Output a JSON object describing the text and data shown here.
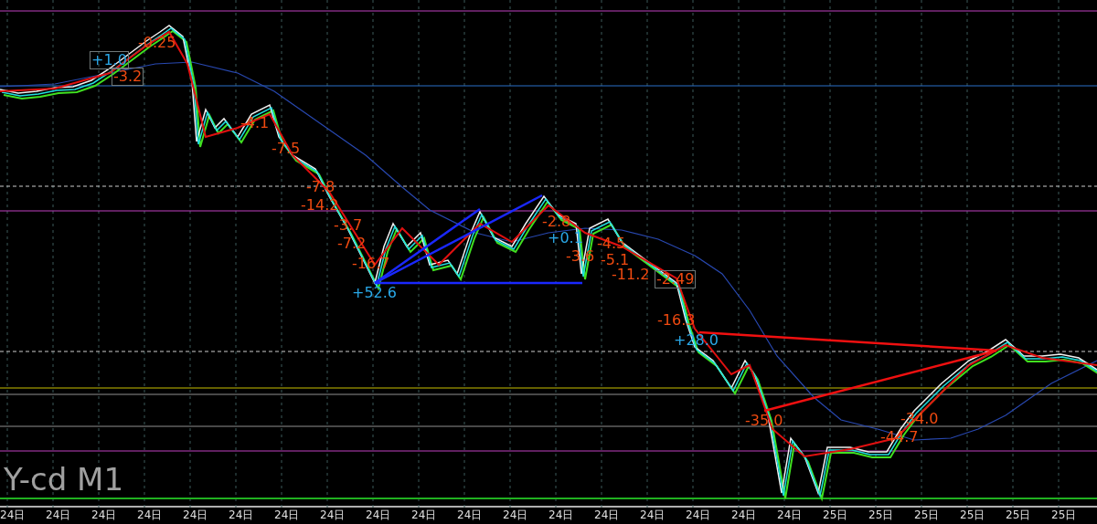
{
  "chart": {
    "symbol_label": "Y-cd M1",
    "annotations": [
      {
        "text": "+1.0",
        "kind": "profit",
        "boxed": true
      },
      {
        "text": "-0.25",
        "kind": "loss",
        "boxed": false
      },
      {
        "text": "-3.2",
        "kind": "loss",
        "boxed": true
      },
      {
        "text": "-4.1",
        "kind": "loss",
        "boxed": false
      },
      {
        "text": "-7.5",
        "kind": "loss",
        "boxed": false
      },
      {
        "text": "-7.8",
        "kind": "loss",
        "boxed": false
      },
      {
        "text": "-14.2",
        "kind": "loss",
        "boxed": false
      },
      {
        "text": "-3.7",
        "kind": "loss",
        "boxed": false
      },
      {
        "text": "-7.2",
        "kind": "loss",
        "boxed": false
      },
      {
        "text": "-16.7",
        "kind": "loss",
        "boxed": false
      },
      {
        "text": "+52.6",
        "kind": "profit",
        "boxed": false
      },
      {
        "text": "-2.8",
        "kind": "loss",
        "boxed": false
      },
      {
        "text": "+0.1",
        "kind": "profit",
        "boxed": false
      },
      {
        "text": "-3.6",
        "kind": "loss",
        "boxed": false
      },
      {
        "text": "-4.5",
        "kind": "loss",
        "boxed": false
      },
      {
        "text": "-5.1",
        "kind": "loss",
        "boxed": false
      },
      {
        "text": "-11.2",
        "kind": "loss",
        "boxed": false
      },
      {
        "text": "-2.49",
        "kind": "loss",
        "boxed": true
      },
      {
        "text": "-16.3",
        "kind": "loss",
        "boxed": false
      },
      {
        "text": "+28.0",
        "kind": "profit",
        "boxed": false
      },
      {
        "text": "-35.0",
        "kind": "loss",
        "boxed": false
      },
      {
        "text": "-34.0",
        "kind": "loss",
        "boxed": false
      },
      {
        "text": "-44.7",
        "kind": "loss",
        "boxed": false
      }
    ],
    "time_labels": [
      "24日",
      "24日",
      "24日",
      "24日",
      "24日",
      "24日",
      "24日",
      "24日",
      "24日",
      "24日",
      "24日",
      "24日",
      "24日",
      "24日",
      "24日",
      "24日",
      "24日",
      "24日",
      "25日",
      "25日",
      "25日",
      "25日",
      "25日",
      "25日"
    ]
  }
}
